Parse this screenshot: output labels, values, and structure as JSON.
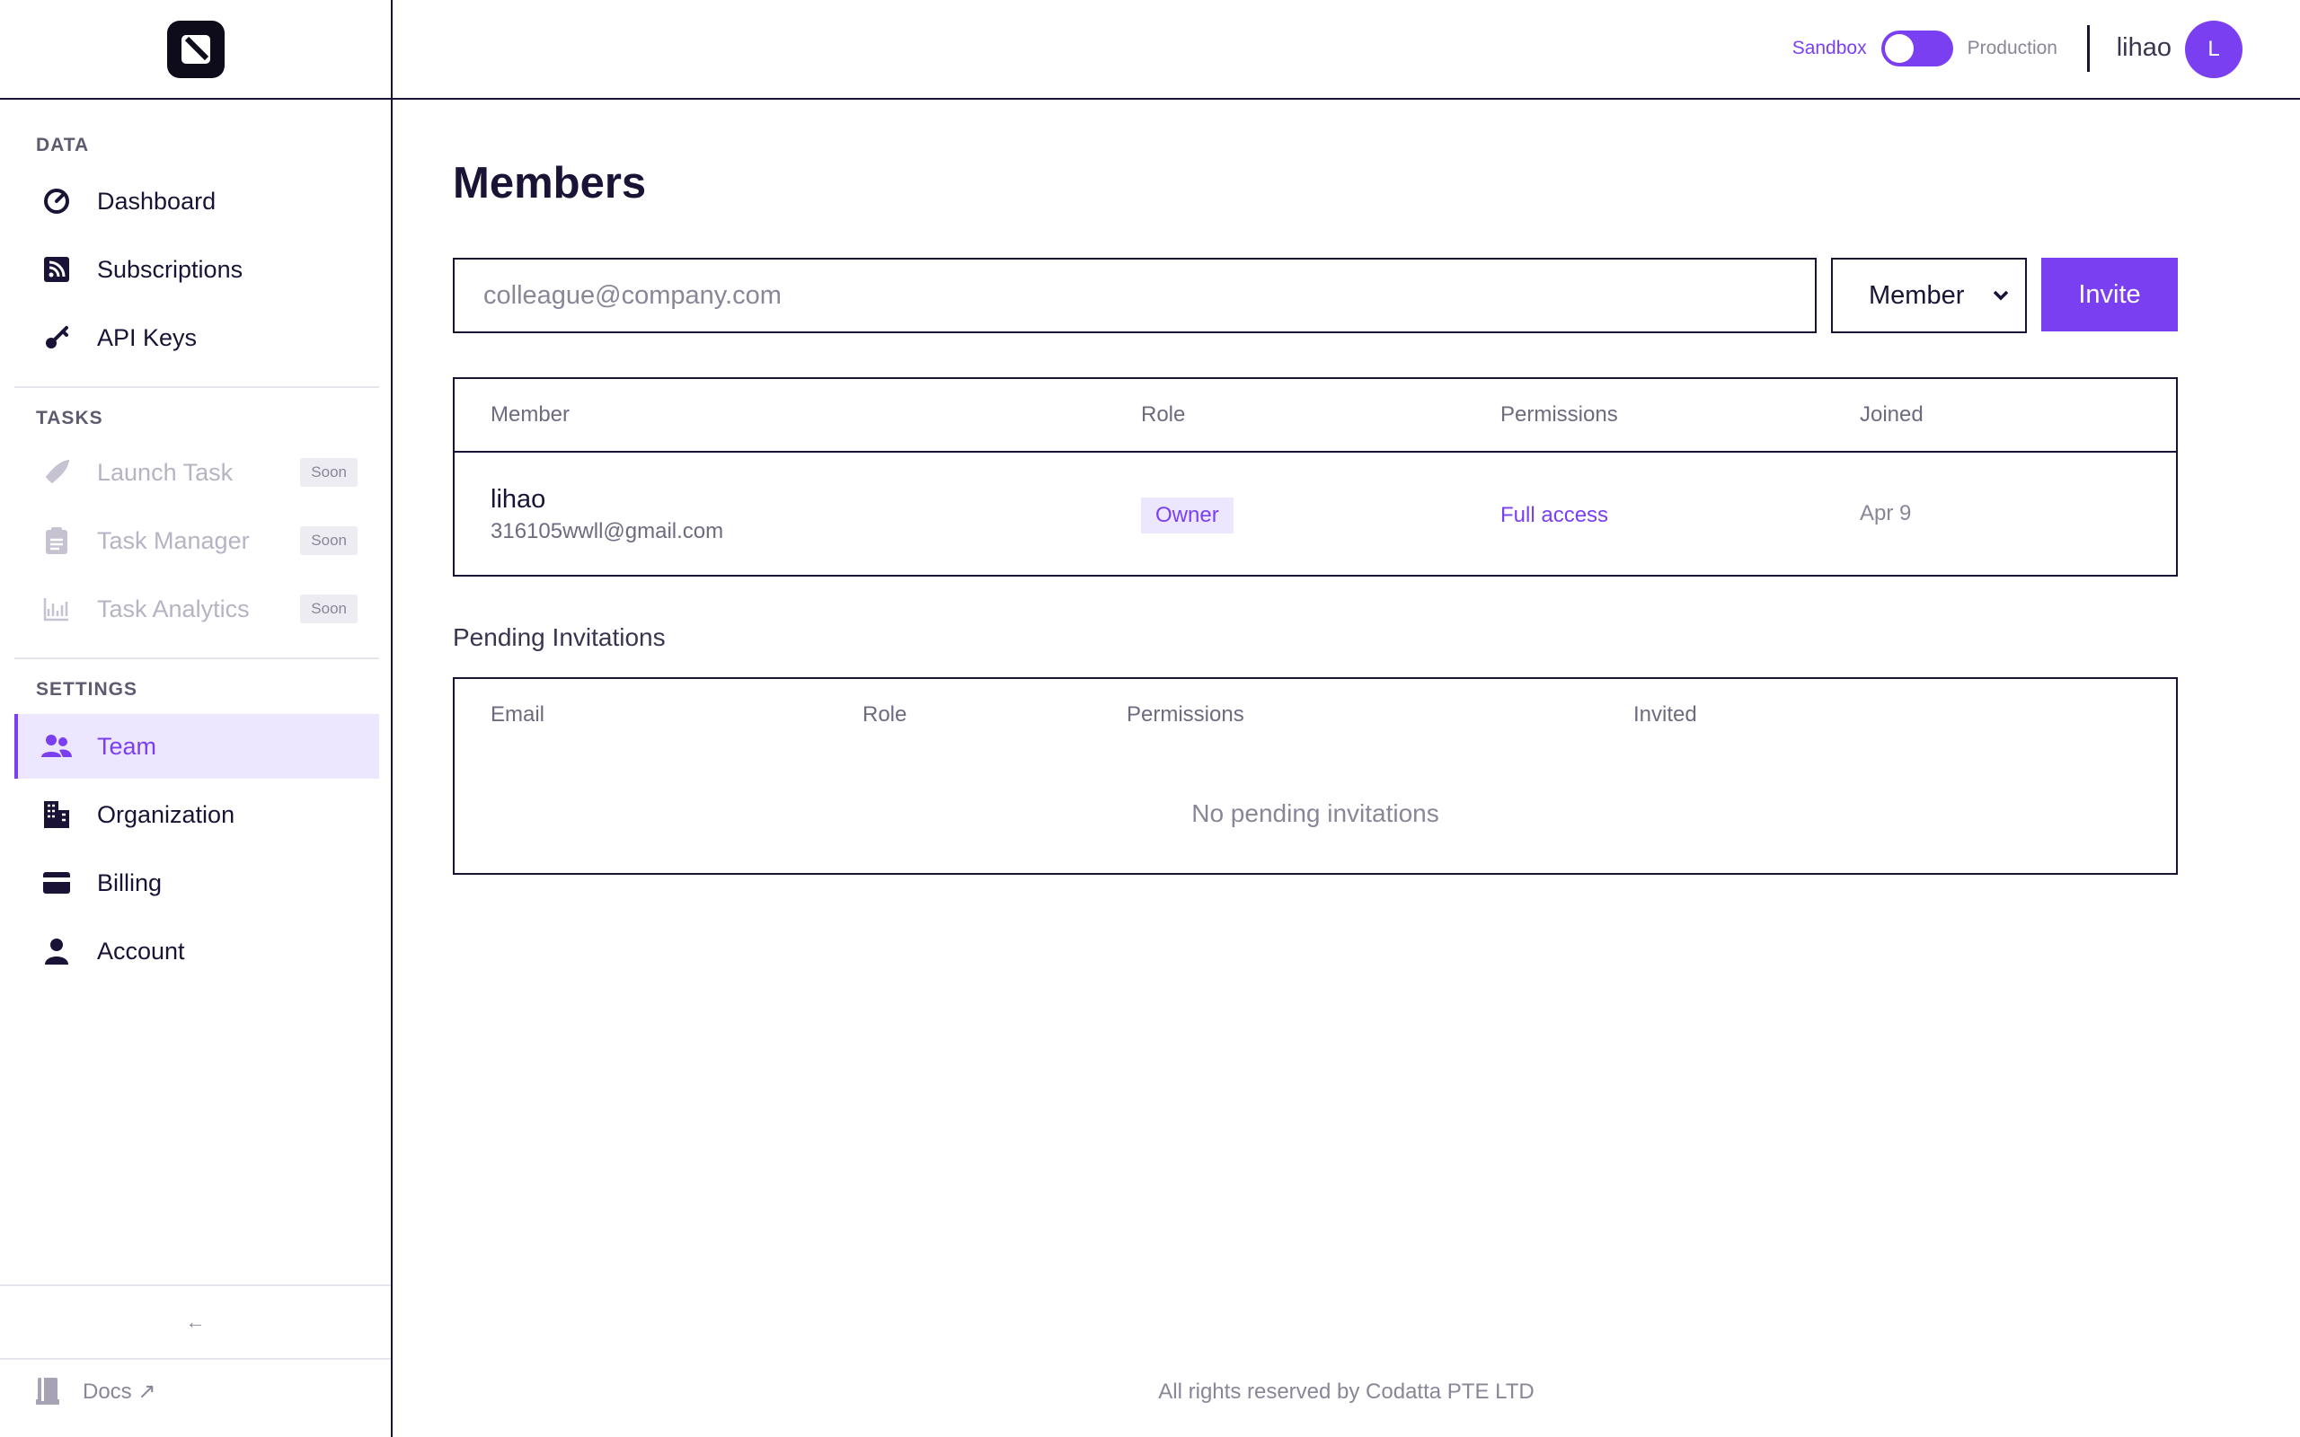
{
  "sidebar": {
    "sections": {
      "data": "DATA",
      "tasks": "TASKS",
      "settings": "SETTINGS"
    },
    "items": {
      "dashboard": "Dashboard",
      "subscriptions": "Subscriptions",
      "api_keys": "API Keys",
      "launch_task": "Launch Task",
      "task_manager": "Task Manager",
      "task_analytics": "Task Analytics",
      "team": "Team",
      "organization": "Organization",
      "billing": "Billing",
      "account": "Account"
    },
    "soon_label": "Soon",
    "collapse_label": "←",
    "docs_label": "Docs ↗"
  },
  "topbar": {
    "env_sandbox": "Sandbox",
    "env_production": "Production",
    "env_mode": "sandbox",
    "username": "lihao",
    "avatar_initial": "L"
  },
  "page": {
    "title": "Members"
  },
  "invite": {
    "email_placeholder": "colleague@company.com",
    "email_value": "",
    "role_selected": "Member",
    "button_label": "Invite"
  },
  "members_table": {
    "headers": [
      "Member",
      "Role",
      "Permissions",
      "Joined"
    ],
    "rows": [
      {
        "name": "lihao",
        "email": "316105wwll@gmail.com",
        "role": "Owner",
        "permissions": "Full access",
        "joined": "Apr 9"
      }
    ]
  },
  "pending": {
    "title": "Pending Invitations",
    "headers": [
      "Email",
      "Role",
      "Permissions",
      "Invited"
    ],
    "empty_message": "No pending invitations"
  },
  "footer": {
    "text": "All rights reserved by Codatta PTE LTD"
  },
  "colors": {
    "accent": "#7b3ff2",
    "accent_light": "#ece6ff",
    "ink": "#1b1336",
    "muted": "#8a8698"
  }
}
